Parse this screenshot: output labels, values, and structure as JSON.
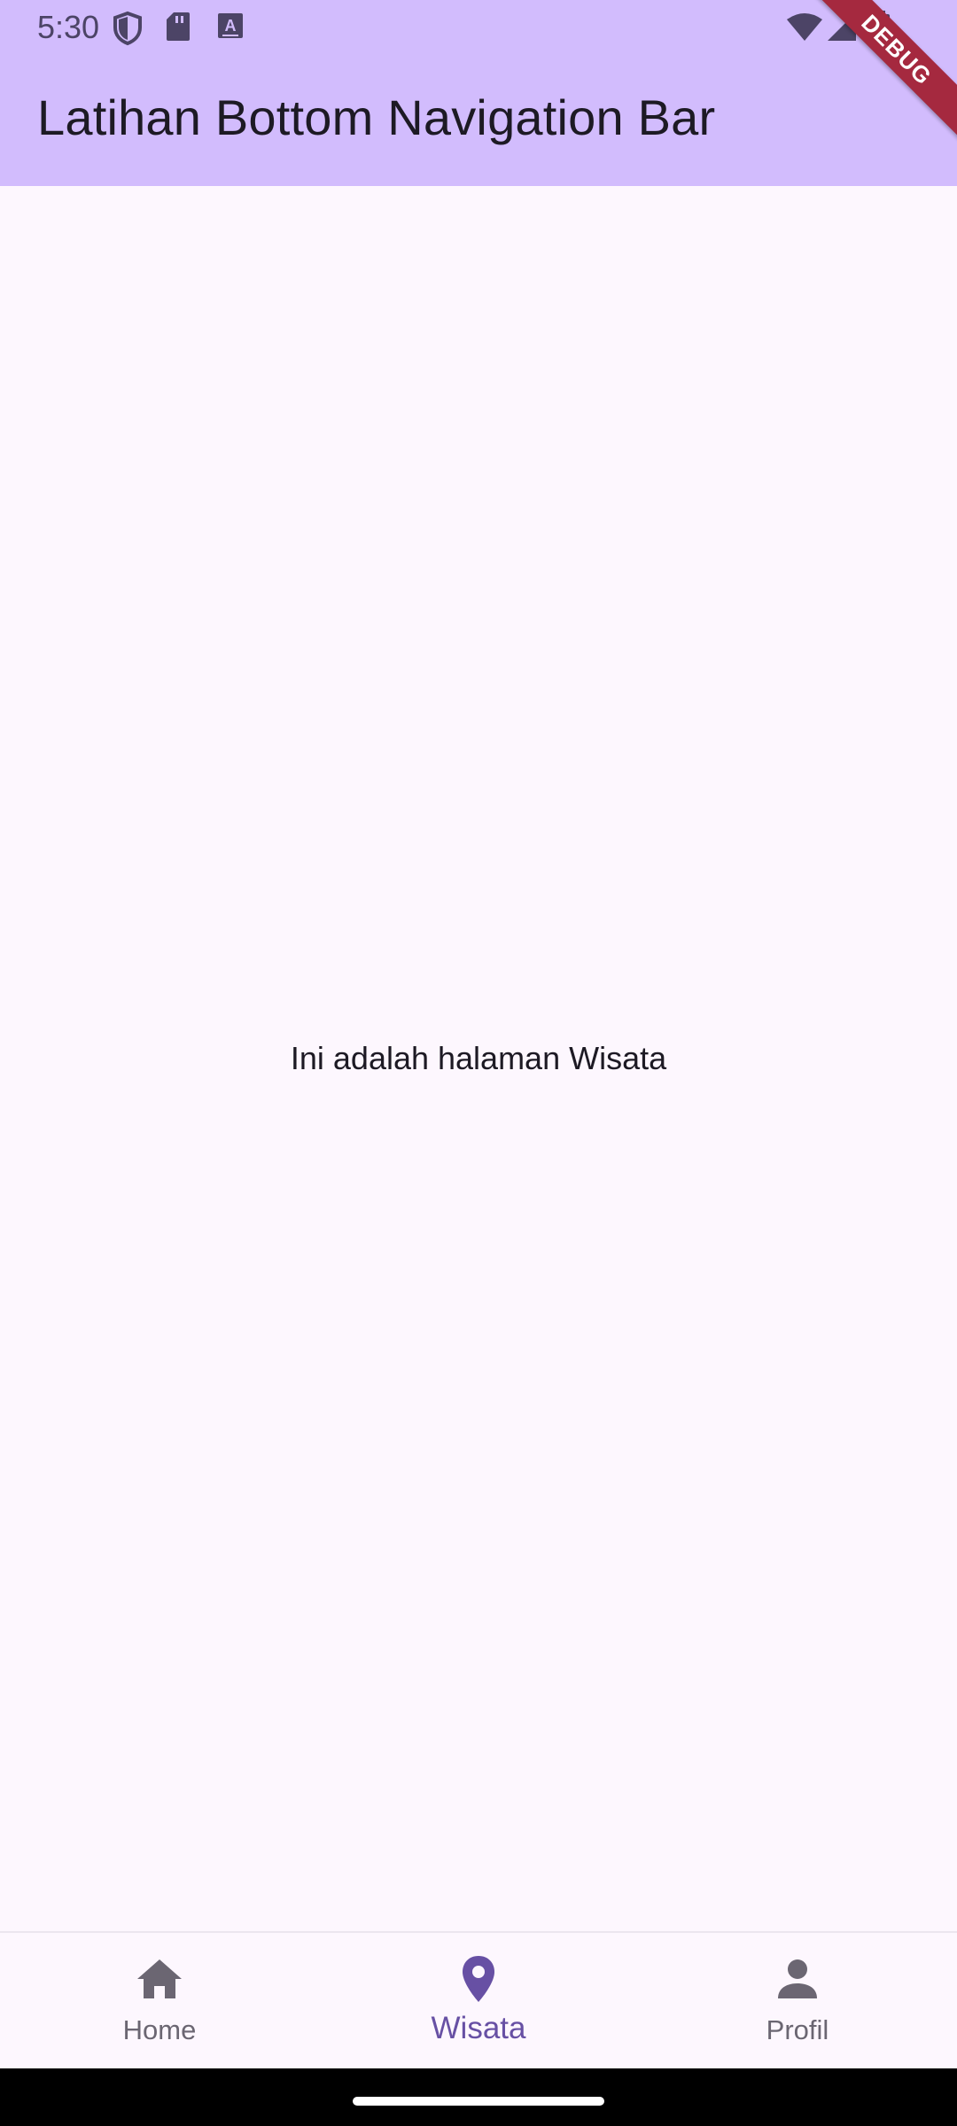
{
  "status_bar": {
    "time": "5:30",
    "left_icons": [
      "shield-icon",
      "sd-card-icon",
      "keyboard-a-icon"
    ],
    "right_icons": [
      "wifi-icon",
      "signal-icon",
      "battery-icon"
    ]
  },
  "app_bar": {
    "title": "Latihan Bottom Navigation Bar",
    "background_color": "#d2bcfd"
  },
  "debug_banner": {
    "label": "DEBUG"
  },
  "body": {
    "text": "Ini adalah halaman Wisata"
  },
  "bottom_nav": {
    "active_index": 1,
    "active_color": "#6750a4",
    "items": [
      {
        "label": "Home",
        "icon": "home-icon"
      },
      {
        "label": "Wisata",
        "icon": "location-pin-icon"
      },
      {
        "label": "Profil",
        "icon": "person-icon"
      }
    ]
  }
}
